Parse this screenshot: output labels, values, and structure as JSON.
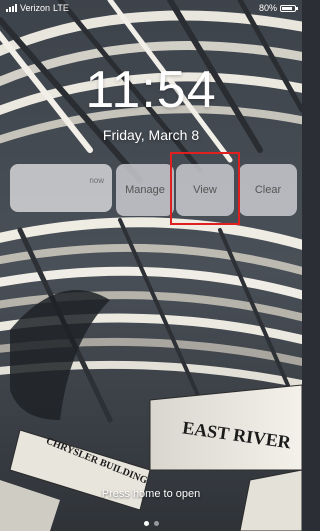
{
  "status_bar": {
    "carrier": "Verizon",
    "network": "LTE",
    "battery": "80%",
    "battery_level": 0.8
  },
  "lock_screen": {
    "time": "11:54",
    "date": "Friday, March 8",
    "unlock_hint": "Press home to open"
  },
  "notification": {
    "time": "now",
    "actions": {
      "manage": "Manage",
      "view": "View",
      "clear": "Clear"
    }
  },
  "wallpaper": {
    "signs": {
      "main": "EAST RIVER",
      "left": "CHRYSLER BUILDING"
    }
  },
  "icons": {
    "signal": "cellular-signal-icon",
    "battery": "battery-icon"
  },
  "colors": {
    "highlight": "#e02020",
    "text": "#ffffff"
  }
}
